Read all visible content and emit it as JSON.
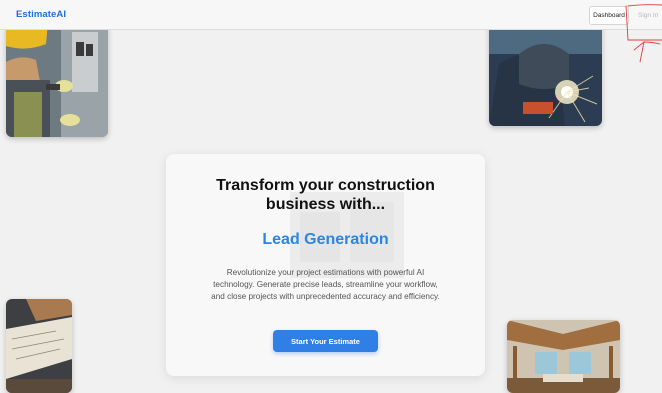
{
  "nav": {
    "logo": "EstimateAI",
    "dashboard_label": "Dashboard",
    "signin_label": "Sign In"
  },
  "hero": {
    "title_line1": "Transform your construction",
    "title_line2": "business with...",
    "highlight": "Lead Generation",
    "desc_line1": "Revolutionize your project estimations with powerful AI",
    "desc_line2": "technology. Generate precise leads, streamline your workflow,",
    "desc_line3": "and close projects with unprecedented accuracy and efficiency.",
    "cta_label": "Start Your Estimate"
  },
  "colors": {
    "accent": "#2f7fe6",
    "logo": "#1f6fd6",
    "highlight": "#2a86e4",
    "annotation": "#e53b3b",
    "background": "#f1f1f1"
  }
}
